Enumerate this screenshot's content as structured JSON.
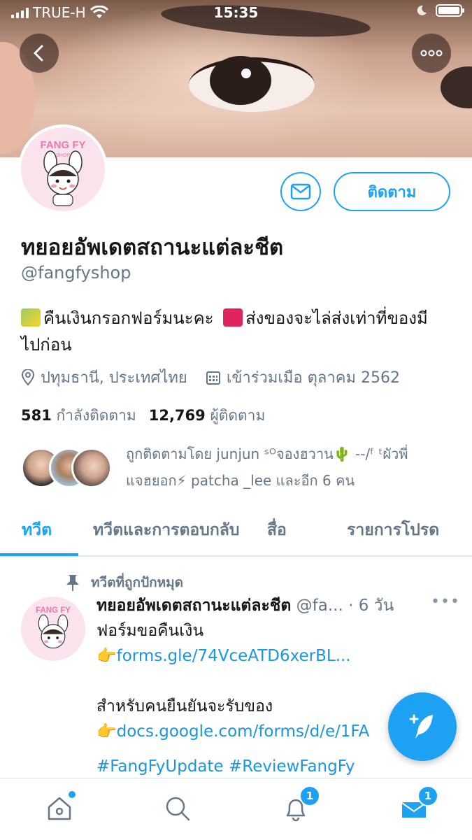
{
  "status_bar": {
    "carrier": "TRUE-H",
    "time": "15:35"
  },
  "profile": {
    "name": "ทยอยอัพเดตสถานะแต่ละชีต",
    "handle": "@fangfyshop",
    "avatar_text_top": "FANG FY",
    "avatar_text_sub": "SHOP",
    "follow_label": "ติดตาม",
    "bio_line1": "คืนเงินกรอกฟอร์มนะคะ",
    "bio_line2": "ส่งของจะไล่ส่งเท่าที่ของมี",
    "bio_line3": "ไปก่อน",
    "location": "ปทุมธานี, ประเทศไทย",
    "joined": "เข้าร่วมเมือ ตุลาคม 2562",
    "following_count": "581",
    "following_label": "กำลังติดตาม",
    "followers_count": "12,769",
    "followers_label": "ผู้ติดตาม",
    "followed_by_line1": "ถูกติดตามโดย junjun ˢᴼจองฮวาน🌵 --/ᶠ ᵗผัวพี่",
    "followed_by_line2": "แจฮยอก⚡ patcha _lee และอีก 6 คน"
  },
  "tabs": [
    "ทวีต",
    "ทวีตและการตอบกลับ",
    "สื่อ",
    "รายการโปรด"
  ],
  "tweet": {
    "pinned_label": "ทวีตที่ถูกปักหมุด",
    "author": "ทยอยอัพเดตสถานะแต่ละชีต",
    "handle": "@fa...",
    "time": "· 6 วัน",
    "more": "•••",
    "line1": "ฟอร์มขอคืนเงิน",
    "link1": "forms.gle/74VceATD6xerBL...",
    "line2": "สำหรับคนยืนยันจะรับของ",
    "link2": "docs.google.com/forms/d/e/1FA",
    "hashtags": "#FangFyUpdate #ReviewFangFy"
  },
  "bottom_nav": {
    "notifications_badge": "1",
    "messages_badge": "1"
  },
  "colors": {
    "accent": "#1da1f2",
    "secondary_text": "#657786"
  }
}
